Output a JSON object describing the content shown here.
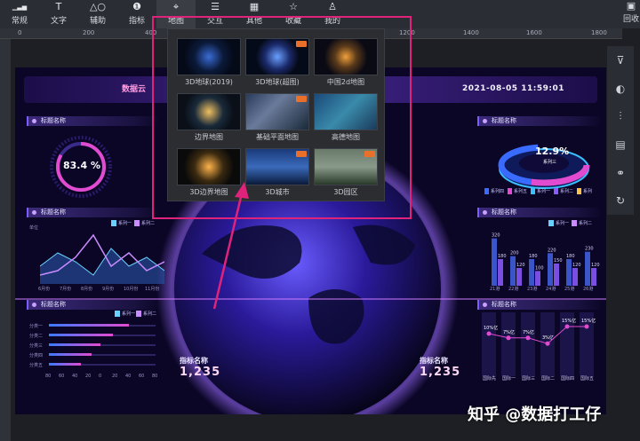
{
  "toolbar": {
    "items": [
      {
        "label": "常规",
        "icon": "chart-bar-icon"
      },
      {
        "label": "文字",
        "icon": "text-icon"
      },
      {
        "label": "辅助",
        "icon": "shapes-icon"
      },
      {
        "label": "指标",
        "icon": "indicator-icon"
      },
      {
        "label": "地图",
        "icon": "map-pin-icon"
      },
      {
        "label": "交互",
        "icon": "sliders-icon"
      },
      {
        "label": "其他",
        "icon": "grid-icon"
      },
      {
        "label": "收藏",
        "icon": "star-icon"
      },
      {
        "label": "我的",
        "icon": "user-icon"
      }
    ],
    "right_label": "回收"
  },
  "ruler": {
    "ticks": [
      "0",
      "200",
      "400",
      "1200",
      "1400",
      "1600",
      "1800"
    ]
  },
  "map_menu": {
    "items": [
      {
        "label": "3D地球(2019)",
        "pro": false
      },
      {
        "label": "3D地球(超图)",
        "pro": true
      },
      {
        "label": "中国2d地图",
        "pro": false
      },
      {
        "label": "边界地图",
        "pro": false
      },
      {
        "label": "基础平面地图",
        "pro": true
      },
      {
        "label": "高德地图",
        "pro": false
      },
      {
        "label": "3D边界地图",
        "pro": false
      },
      {
        "label": "3D城市",
        "pro": true
      },
      {
        "label": "3D园区",
        "pro": true
      }
    ]
  },
  "dashboard": {
    "brand": "数据云",
    "datetime": "2021-08-05  11:59:01",
    "panel_title": "标题名称",
    "ring_left": {
      "value": "83.4 %",
      "fraction": 0.834
    },
    "ring_right": {
      "value": "12.9%",
      "label": "系列三"
    },
    "legend_right": [
      "系列四",
      "系列五",
      "系列一",
      "系列二",
      "系列"
    ],
    "line_legend": [
      "系列一",
      "系列二"
    ],
    "line_months": [
      "6月份",
      "7月份",
      "8月份",
      "9月份",
      "10月份",
      "11月份"
    ],
    "line_yunit": "单位",
    "bar_legend": [
      "系列一",
      "系列二"
    ],
    "bar_xlabels": [
      "21港",
      "22港",
      "23港",
      "24港",
      "25港",
      "26港"
    ],
    "bar_values": [
      320,
      200,
      180,
      220,
      180,
      230
    ],
    "bar_values2": [
      180,
      120,
      100,
      150,
      120,
      120
    ],
    "hbar_legend": [
      "系列一",
      "系列二"
    ],
    "hbar_rows": [
      "分类一",
      "分类二",
      "分类三",
      "分类四",
      "分类五"
    ],
    "hbar_values": [
      75,
      60,
      48,
      40,
      30
    ],
    "hbar_xticks": [
      "80",
      "60",
      "40",
      "20",
      "0",
      "20",
      "40",
      "60",
      "80"
    ],
    "tag_labels": [
      "10%亿",
      "7%亿",
      "7%亿",
      "3%亿",
      "15%亿",
      "15%亿"
    ],
    "tag_values": [
      10,
      7,
      7,
      3,
      15,
      15
    ],
    "tag_cols": [
      "国际先",
      "国际一",
      "国际三",
      "国际二",
      "国际四",
      "国际五"
    ],
    "metric_left": {
      "label": "指标名称",
      "value": "1,235"
    },
    "metric_right": {
      "label": "指标名称",
      "value": "1,235"
    }
  },
  "watermark": "知乎 @数据打工仔",
  "colors": {
    "highlight": "#e0237a",
    "accent": "#7b5cff",
    "pro_badge": "#e8702a"
  }
}
